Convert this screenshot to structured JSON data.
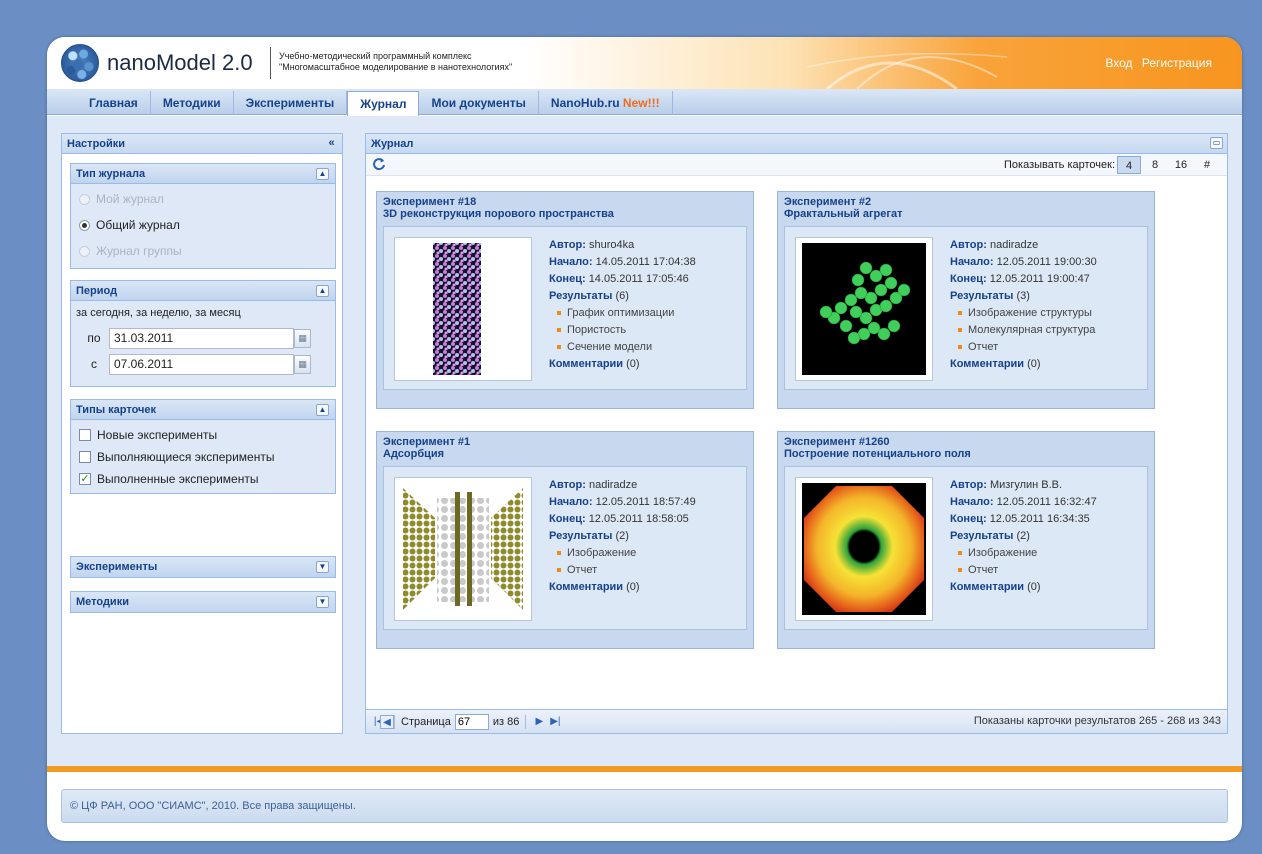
{
  "header": {
    "app_name": "nanoModel 2.0",
    "subtitle_line1": "Учебно-методический программный комплекс",
    "subtitle_line2": "\"Многомасштабное моделирование в нанотехнологиях\"",
    "login": "Вход",
    "register": "Регистрация"
  },
  "nav": {
    "tabs": [
      {
        "label": "Главная"
      },
      {
        "label": "Методики"
      },
      {
        "label": "Эксперименты"
      },
      {
        "label": "Журнал"
      },
      {
        "label": "Мои документы"
      },
      {
        "label": "NanoHub.ru",
        "badge": "New!!!"
      }
    ],
    "active": "Журнал"
  },
  "settings": {
    "title": "Настройки",
    "journal_type": {
      "title": "Тип журнала",
      "options": [
        "Мой журнал",
        "Общий журнал",
        "Журнал группы"
      ],
      "selected": "Общий журнал"
    },
    "period": {
      "title": "Период",
      "hint": "за сегодня, за неделю, за месяц",
      "to_label": "по",
      "to_value": "31.03.2011",
      "from_label": "с",
      "from_value": "07.06.2011"
    },
    "card_types": {
      "title": "Типы карточек",
      "options": [
        {
          "label": "Новые эксперименты",
          "checked": false
        },
        {
          "label": "Выполняющиеся эксперименты",
          "checked": false
        },
        {
          "label": "Выполненные эксперименты",
          "checked": true
        }
      ]
    },
    "experiments_title": "Эксперименты",
    "methods_title": "Методики"
  },
  "journal": {
    "title": "Журнал",
    "show_cards_label": "Показывать карточек:",
    "page_sizes": [
      "4",
      "8",
      "16",
      "#"
    ],
    "page_size_selected": "4",
    "labels": {
      "author": "Автор:",
      "start": "Начало:",
      "end": "Конец:",
      "results": "Результаты",
      "comments": "Комментарии"
    },
    "cards": [
      {
        "title": "Эксперимент #18",
        "subtitle": "3D реконструкция порового пространства",
        "author": "shuro4ka",
        "start": "14.05.2011 17:04:38",
        "end": "14.05.2011 17:05:46",
        "results_count": "(6)",
        "results": [
          "График оптимизации",
          "Пористость",
          "Сечение модели"
        ],
        "comments": "(0)"
      },
      {
        "title": "Эксперимент #2",
        "subtitle": "Фрактальный агрегат",
        "author": "nadiradze",
        "start": "12.05.2011 19:00:30",
        "end": "12.05.2011 19:00:47",
        "results_count": "(3)",
        "results": [
          "Изображение структуры",
          "Молекулярная структура",
          "Отчет"
        ],
        "comments": "(0)"
      },
      {
        "title": "Эксперимент #1",
        "subtitle": "Адсорбция",
        "author": "nadiradze",
        "start": "12.05.2011 18:57:49",
        "end": "12.05.2011 18:58:05",
        "results_count": "(2)",
        "results": [
          "Изображение",
          "Отчет"
        ],
        "comments": "(0)"
      },
      {
        "title": "Эксперимент #1260",
        "subtitle": "Построение потенциального поля",
        "author": "Мизгулин В.В.",
        "start": "12.05.2011 16:32:47",
        "end": "12.05.2011 16:34:35",
        "results_count": "(2)",
        "results": [
          "Изображение",
          "Отчет"
        ],
        "comments": "(0)"
      }
    ],
    "pager": {
      "page_label": "Страница",
      "page": "67",
      "of_label": "из 86",
      "summary": "Показаны карточки результатов 265 - 268 из 343"
    }
  },
  "footer": {
    "copyright": "© ЦФ РАН, ООО \"СИАМС\", 2010. Все права защищены."
  },
  "colors": {
    "accent_orange": "#f7951f",
    "header_blue": "#15428b",
    "background": "#6b8fc4"
  }
}
